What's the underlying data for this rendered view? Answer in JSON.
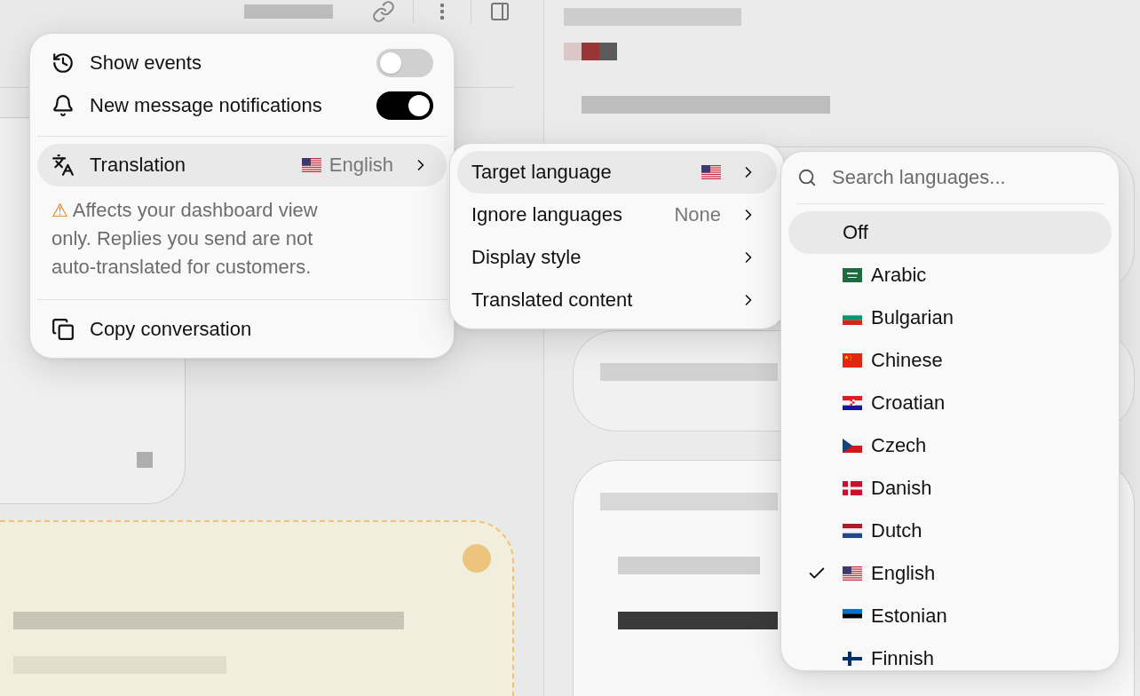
{
  "settings_menu": {
    "sections": [
      {
        "items": [
          {
            "kind": "toggle",
            "label": "Show events",
            "on": false
          },
          {
            "kind": "toggle",
            "label": "New message notifications",
            "on": true
          }
        ]
      },
      {
        "items": [
          {
            "kind": "submenu",
            "label": "Translation",
            "value": "English",
            "highlighted": true
          },
          {
            "kind": "note",
            "text": "⚠ Affects your dashboard view only. Replies you send are not auto-translated for customers."
          }
        ]
      },
      {
        "items": [
          {
            "kind": "action",
            "label": "Copy conversation",
            "highlighted": false
          }
        ]
      }
    ]
  },
  "translation_menu": {
    "items": [
      {
        "kind": "flag",
        "label": "Target language",
        "highlighted": true
      },
      {
        "kind": "value",
        "label": "Ignore languages",
        "value": "None",
        "highlighted": false
      },
      {
        "kind": "plain",
        "label": "Display style",
        "highlighted": false
      },
      {
        "kind": "plain",
        "label": "Translated content",
        "highlighted": false
      }
    ]
  },
  "language_menu": {
    "search": {
      "placeholder": "Search languages..."
    },
    "items": [
      {
        "kind": "off",
        "label": "Off",
        "checked": false,
        "highlighted": true
      },
      {
        "kind": "flag",
        "label": "Arabic",
        "checked": false,
        "highlighted": false
      },
      {
        "kind": "flag",
        "label": "Bulgarian",
        "checked": false,
        "highlighted": false
      },
      {
        "kind": "flag",
        "label": "Chinese",
        "checked": false,
        "highlighted": false
      },
      {
        "kind": "flag",
        "label": "Croatian",
        "checked": false,
        "highlighted": false
      },
      {
        "kind": "flag",
        "label": "Czech",
        "checked": false,
        "highlighted": false
      },
      {
        "kind": "flag",
        "label": "Danish",
        "checked": false,
        "highlighted": false
      },
      {
        "kind": "flag",
        "label": "Dutch",
        "checked": false,
        "highlighted": false
      },
      {
        "kind": "flag",
        "label": "English",
        "checked": true,
        "highlighted": false
      },
      {
        "kind": "flag",
        "label": "Estonian",
        "checked": false,
        "highlighted": false
      },
      {
        "kind": "flag",
        "label": "Finnish",
        "checked": false,
        "highlighted": false
      }
    ]
  }
}
